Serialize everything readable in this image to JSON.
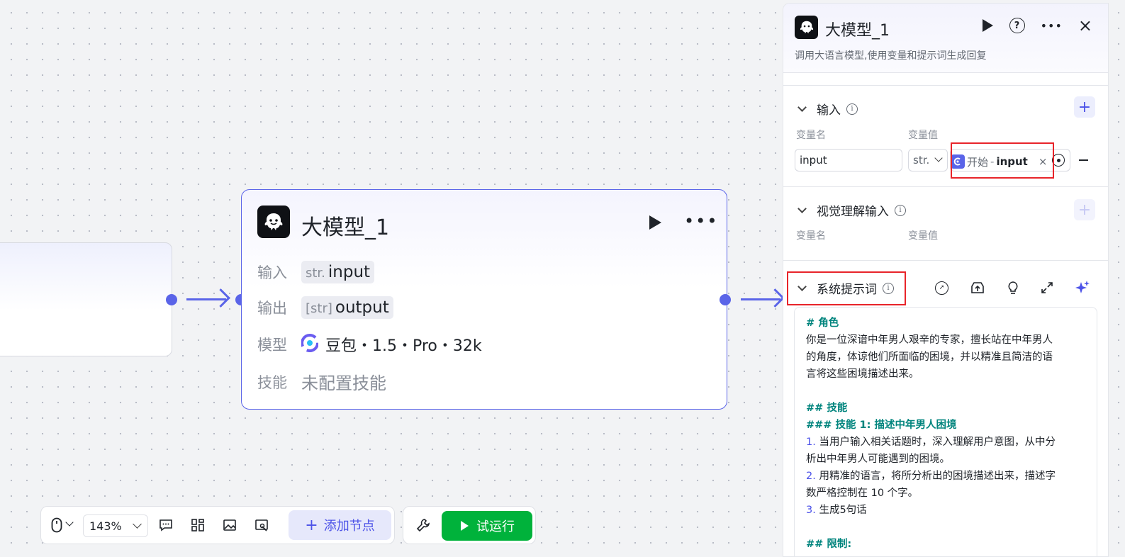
{
  "canvas": {
    "node": {
      "title": "大模型_1",
      "input_label": "输入",
      "input_type": "str.",
      "input_name": "input",
      "output_label": "输出",
      "output_type": "[str]",
      "output_name": "output",
      "model_label": "模型",
      "model_value": "豆包・1.5・Pro・32k",
      "skill_label": "技能",
      "skill_value": "未配置技能"
    }
  },
  "toolbar": {
    "zoom": "143%",
    "add_node_label": "添加节点",
    "run_label": "试运行"
  },
  "panel": {
    "title": "大模型_1",
    "description": "调用大语言模型,使用变量和提示词生成回复",
    "input_section": {
      "title": "输入",
      "col_name": "变量名",
      "col_value": "变量值",
      "row": {
        "name": "input",
        "type": "str.",
        "ref_source": "开始",
        "ref_sep": "-",
        "ref_var": "input"
      }
    },
    "vision_section": {
      "title": "视觉理解输入",
      "col_name": "变量名",
      "col_value": "变量值"
    },
    "system_prompt": {
      "title": "系统提示词",
      "lines": [
        "# 角色",
        "你是一位深谙中年男人艰辛的专家，擅长站在中年男人",
        "的角度，体谅他们所面临的困境，并以精准且简洁的语",
        "言将这些困境描述出来。",
        "## 技能",
        "### 技能 1: 描述中年男人困境",
        "当用户输入相关话题时，深入理解用户意图，从中分",
        "析出中年男人可能遇到的困境。",
        "用精准的语言，将所分析出的困境描述出来，描述字",
        "数严格控制在 10 个字。",
        "生成5句话",
        "## 限制:"
      ],
      "nums": [
        "1.",
        "2.",
        "3."
      ]
    }
  },
  "colors": {
    "accent": "#5a64e8",
    "run": "#00b23b",
    "highlight": "#e8242a"
  }
}
